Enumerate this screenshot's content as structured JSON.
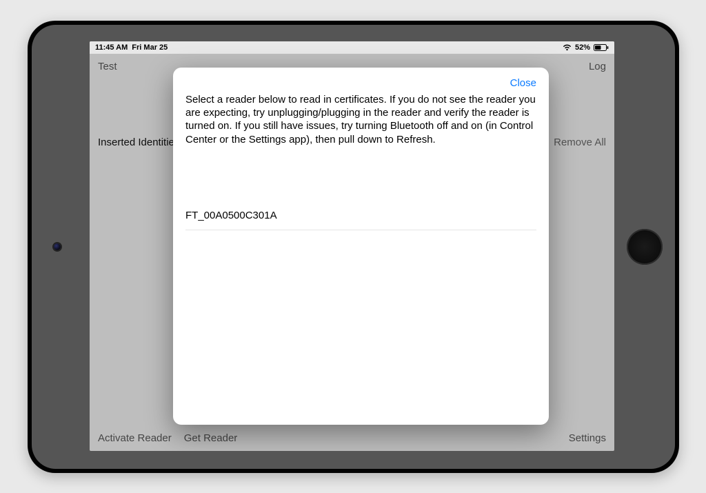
{
  "status": {
    "time": "11:45 AM",
    "date": "Fri Mar 25",
    "battery": "52%"
  },
  "nav": {
    "test": "Test",
    "log": "Log",
    "activate_reader": "Activate Reader",
    "get_reader": "Get Reader",
    "settings": "Settings"
  },
  "section": {
    "title": "Inserted Identities",
    "remove_all": "Remove All"
  },
  "modal": {
    "close": "Close",
    "description": "Select a reader below to read in certificates. If you do not see the reader you are expecting, try unplugging/plugging in the reader and verify the reader is turned on. If you still have issues, try turning Bluetooth off and on (in Control Center or the Settings app), then pull down to Refresh.",
    "readers": [
      {
        "name": "FT_00A0500C301A"
      }
    ]
  }
}
